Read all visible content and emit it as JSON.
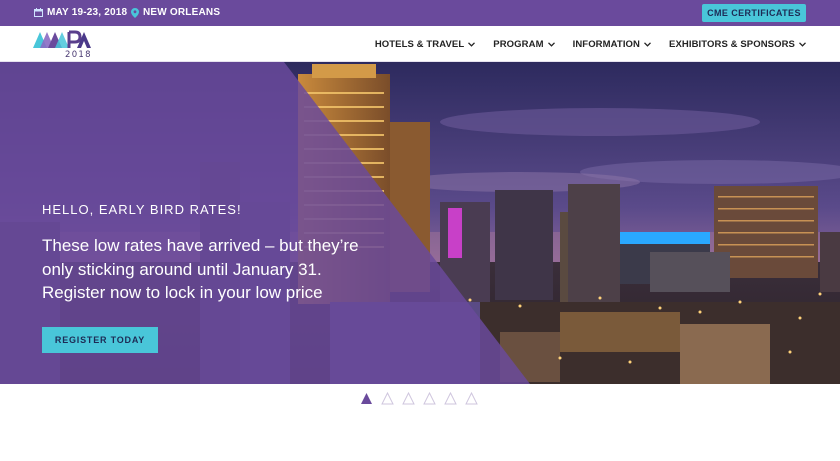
{
  "topbar": {
    "date": "MAY 19-23, 2018",
    "location": "NEW ORLEANS",
    "cme_label": "CME CERTIFICATES"
  },
  "logo": {
    "letters": "AAPA",
    "year": "2018"
  },
  "nav": {
    "items": [
      {
        "label": "HOTELS & TRAVEL"
      },
      {
        "label": "PROGRAM"
      },
      {
        "label": "INFORMATION"
      },
      {
        "label": "EXHIBITORS & SPONSORS"
      }
    ]
  },
  "hero": {
    "kicker": "HELLO, EARLY BIRD RATES!",
    "headline": "These low rates have arrived – but they’re only sticking around until January 31. Register now to lock in your low price",
    "cta": "REGISTER TODAY"
  },
  "slider": {
    "total_slides": 6,
    "active_index": 0
  },
  "colors": {
    "purple": "#6a4a9c",
    "teal": "#49c6d9",
    "navy": "#1d2b55"
  }
}
